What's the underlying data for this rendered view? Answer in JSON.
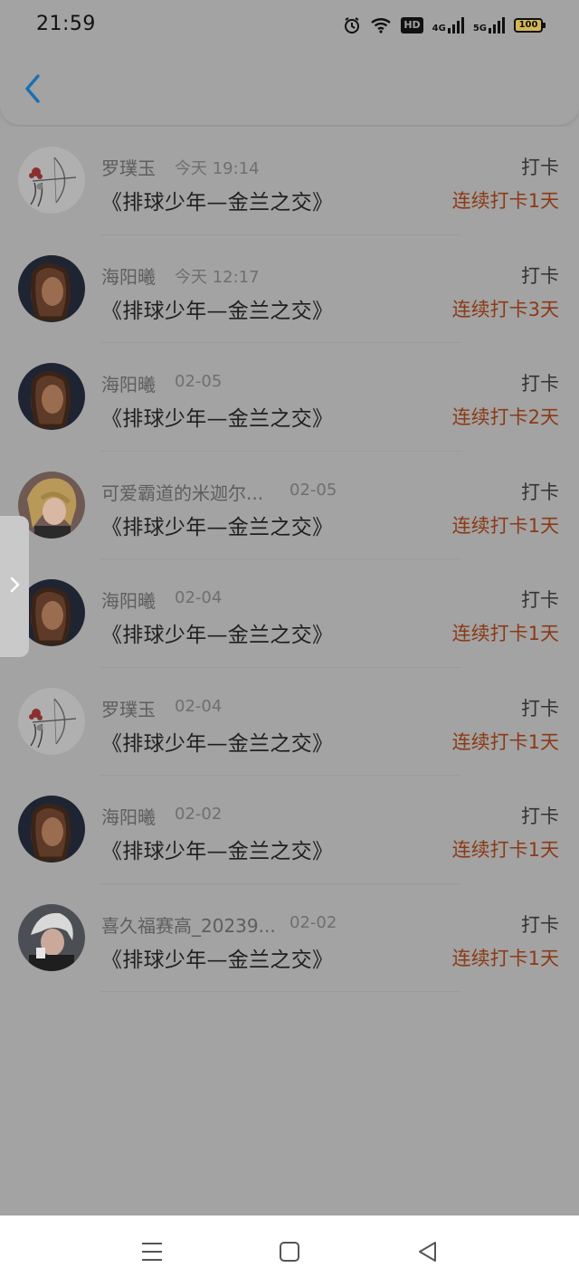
{
  "status_bar": {
    "time": "21:59",
    "hd_label": "HD",
    "net_4g_label": "4G",
    "net_5g_label": "5G",
    "battery": "100",
    "icons": [
      "alarm-icon",
      "wifi-icon",
      "hd-icon",
      "signal-4g-icon",
      "signal-5g-icon",
      "battery-icon"
    ]
  },
  "header": {
    "back_icon": "chevron-left-icon",
    "accent_color": "#1a6fb0"
  },
  "side_handle": {
    "icon": "chevron-right-icon"
  },
  "colors": {
    "streak": "#8b3a16",
    "background": "#a3a3a3"
  },
  "list": {
    "items": [
      {
        "name": "罗璞玉",
        "time": "今天 19:14",
        "title": "《排球少年—金兰之交》",
        "action": "打卡",
        "streak": "连续打卡1天",
        "avatar": "archer-sketch"
      },
      {
        "name": "海阳曦",
        "time": "今天 12:17",
        "title": "《排球少年—金兰之交》",
        "action": "打卡",
        "streak": "连续打卡3天",
        "avatar": "dark-portrait"
      },
      {
        "name": "海阳曦",
        "time": "02-05",
        "title": "《排球少年—金兰之交》",
        "action": "打卡",
        "streak": "连续打卡2天",
        "avatar": "dark-portrait"
      },
      {
        "name": "可爱霸道的米迦尔...",
        "time": "02-05",
        "title": "《排球少年—金兰之交》",
        "action": "打卡",
        "streak": "连续打卡1天",
        "avatar": "blonde-anime"
      },
      {
        "name": "海阳曦",
        "time": "02-04",
        "title": "《排球少年—金兰之交》",
        "action": "打卡",
        "streak": "连续打卡1天",
        "avatar": "dark-portrait"
      },
      {
        "name": "罗璞玉",
        "time": "02-04",
        "title": "《排球少年—金兰之交》",
        "action": "打卡",
        "streak": "连续打卡1天",
        "avatar": "archer-sketch"
      },
      {
        "name": "海阳曦",
        "time": "02-02",
        "title": "《排球少年—金兰之交》",
        "action": "打卡",
        "streak": "连续打卡1天",
        "avatar": "dark-portrait"
      },
      {
        "name": "喜久福赛高_20239...",
        "time": "02-02",
        "title": "《排球少年—金兰之交》",
        "action": "打卡",
        "streak": "连续打卡1天",
        "avatar": "white-hair-anime"
      }
    ]
  },
  "nav_bar": {
    "icons": [
      "menu-icon",
      "home-square-icon",
      "back-triangle-icon"
    ]
  }
}
